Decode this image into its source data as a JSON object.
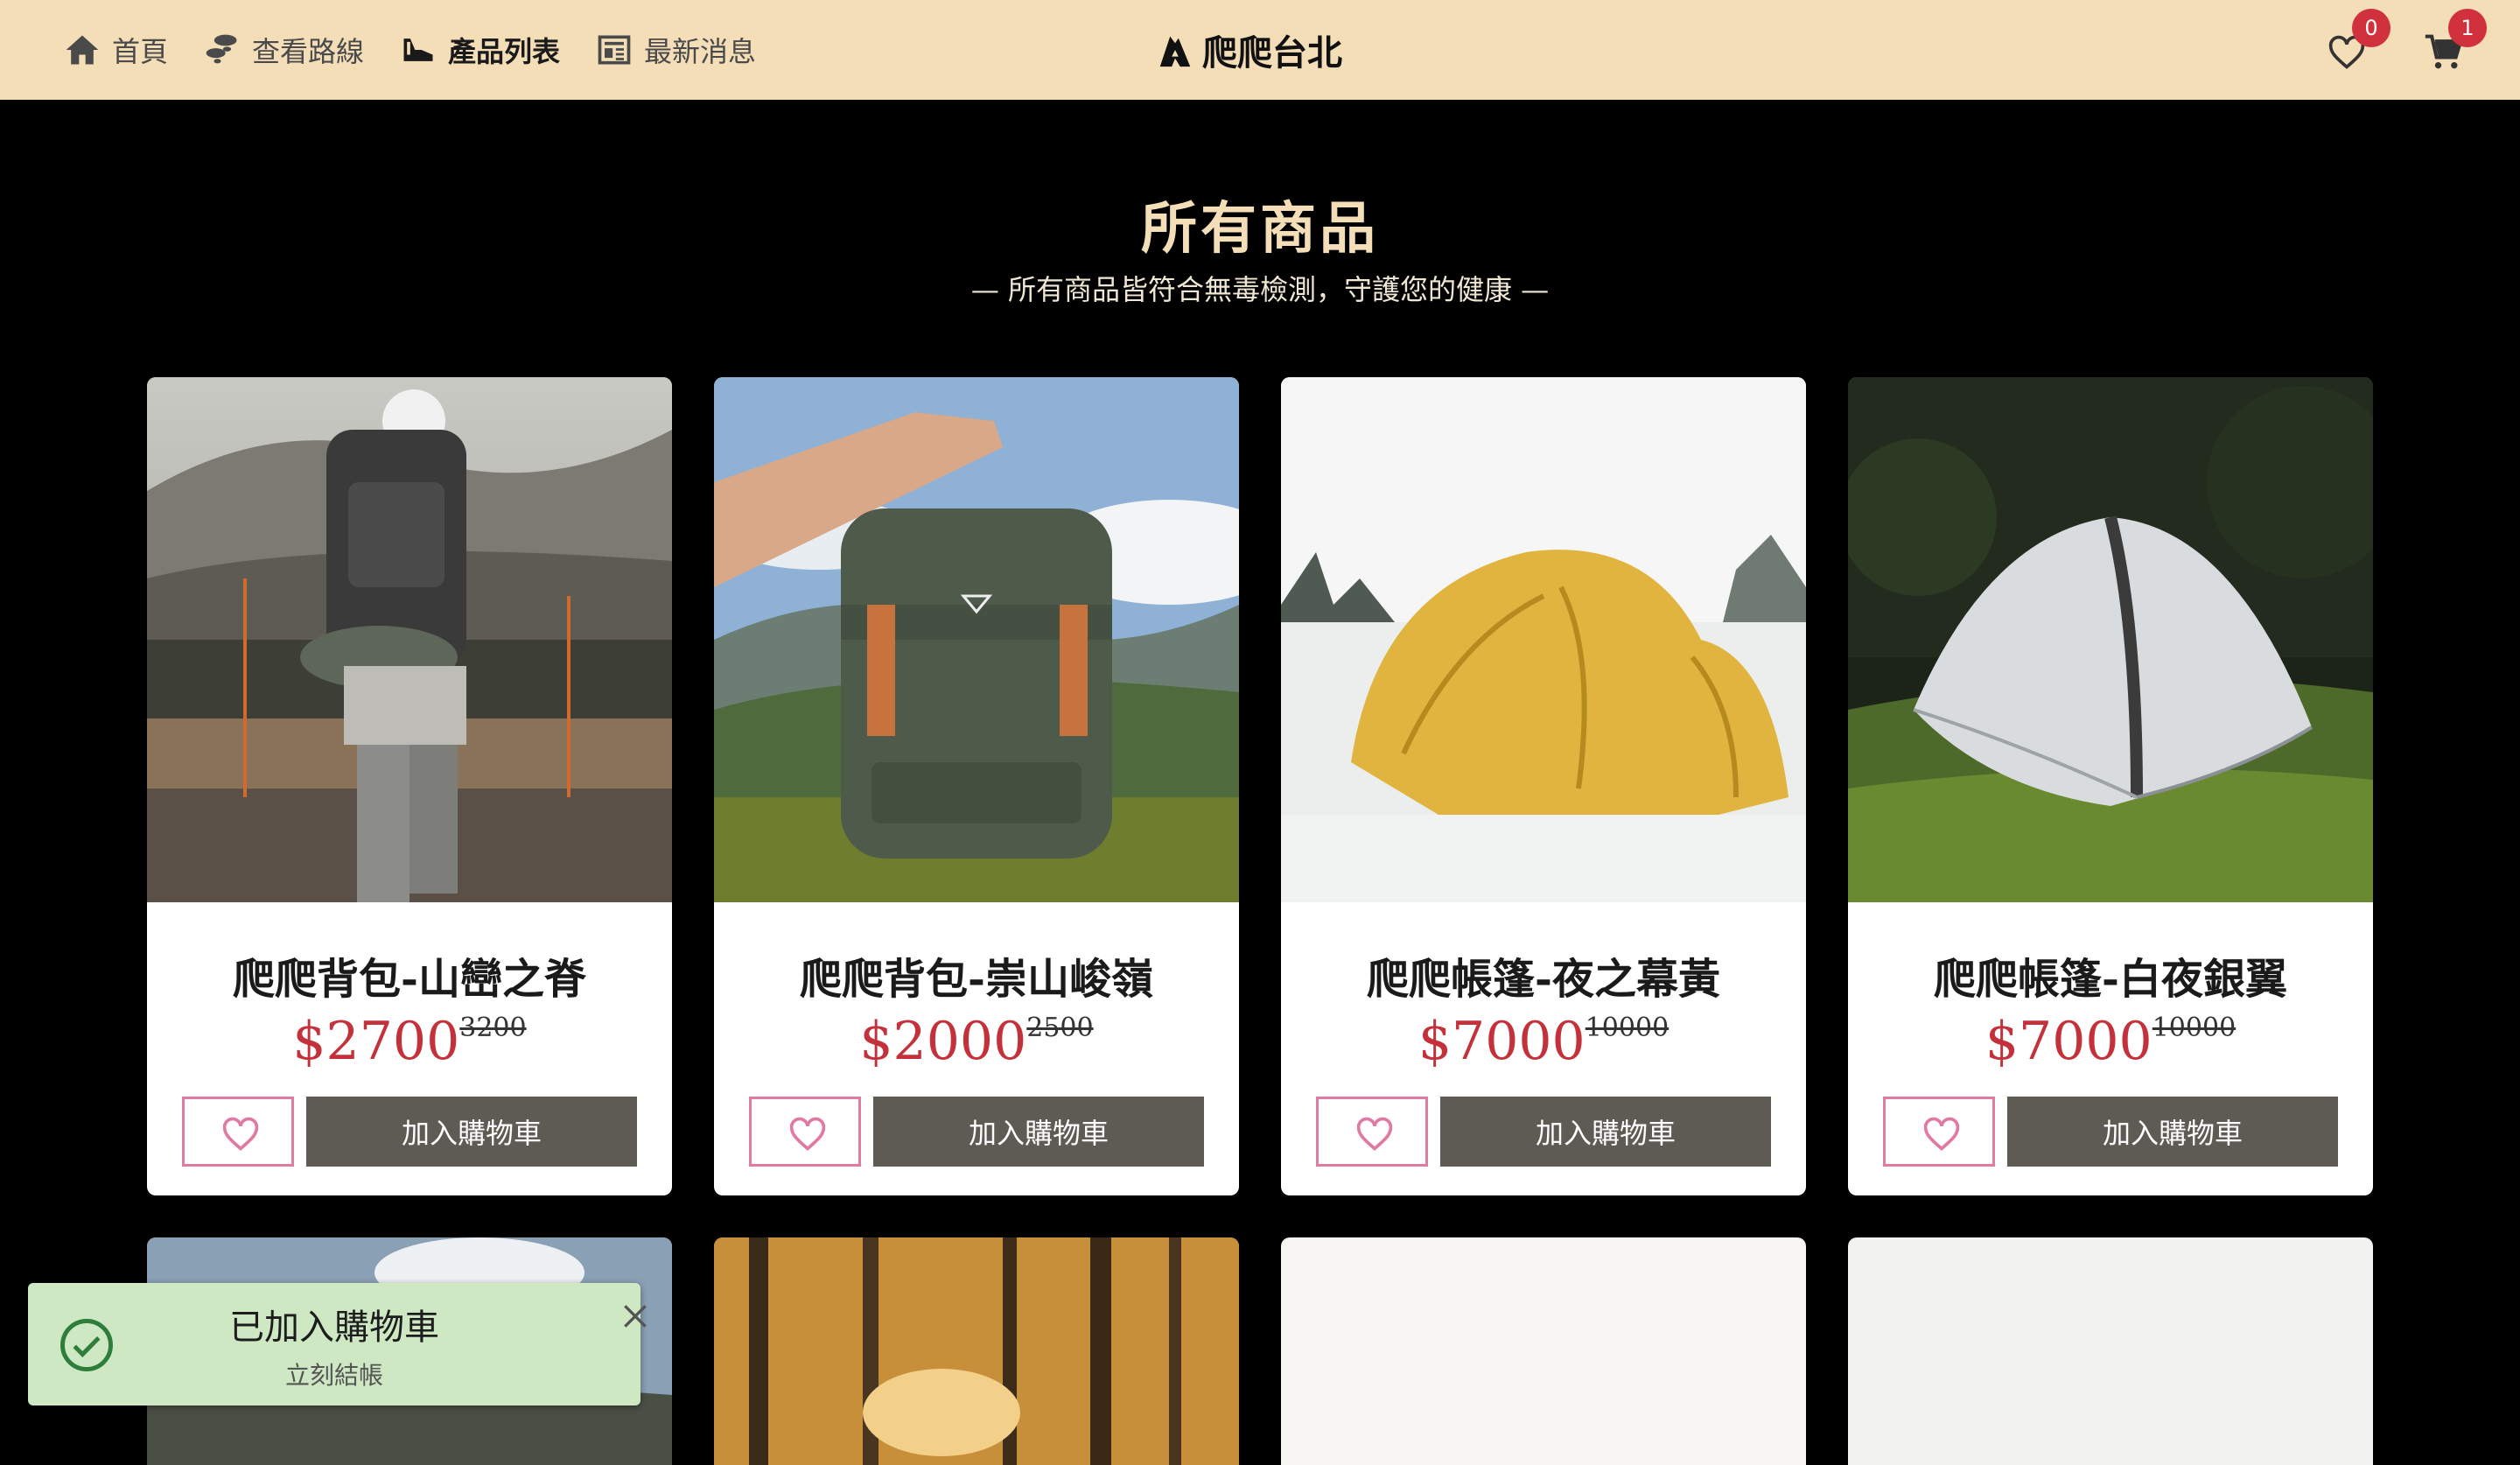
{
  "header": {
    "nav": [
      {
        "label": "首頁",
        "icon": "home-icon"
      },
      {
        "label": "查看路線",
        "icon": "footprints-icon"
      },
      {
        "label": "產品列表",
        "icon": "shoe-icon",
        "active": true
      },
      {
        "label": "最新消息",
        "icon": "newspaper-icon"
      }
    ],
    "logo_text": "爬爬台北",
    "wishlist_count": "0",
    "cart_count": "1"
  },
  "page": {
    "title": "所有商品",
    "subtitle": "— 所有商品皆符合無毒檢測，守護您的健康 —"
  },
  "products": [
    {
      "name": "爬爬背包-山巒之脊",
      "price": "$2700",
      "old_price": "3200",
      "add_label": "加入購物車"
    },
    {
      "name": "爬爬背包-崇山峻嶺",
      "price": "$2000",
      "old_price": "2500",
      "add_label": "加入購物車"
    },
    {
      "name": "爬爬帳篷-夜之幕黃",
      "price": "$7000",
      "old_price": "10000",
      "add_label": "加入購物車"
    },
    {
      "name": "爬爬帳篷-白夜銀翼",
      "price": "$7000",
      "old_price": "10000",
      "add_label": "加入購物車"
    }
  ],
  "toast": {
    "title": "已加入購物車",
    "action": "立刻結帳"
  },
  "colors": {
    "header_bg": "#f3deb8",
    "price": "#c4313b",
    "button_bg": "#5e5a54",
    "fav_border": "#e07aa3",
    "badge": "#d0313d",
    "toast_bg": "#cde8c2"
  }
}
